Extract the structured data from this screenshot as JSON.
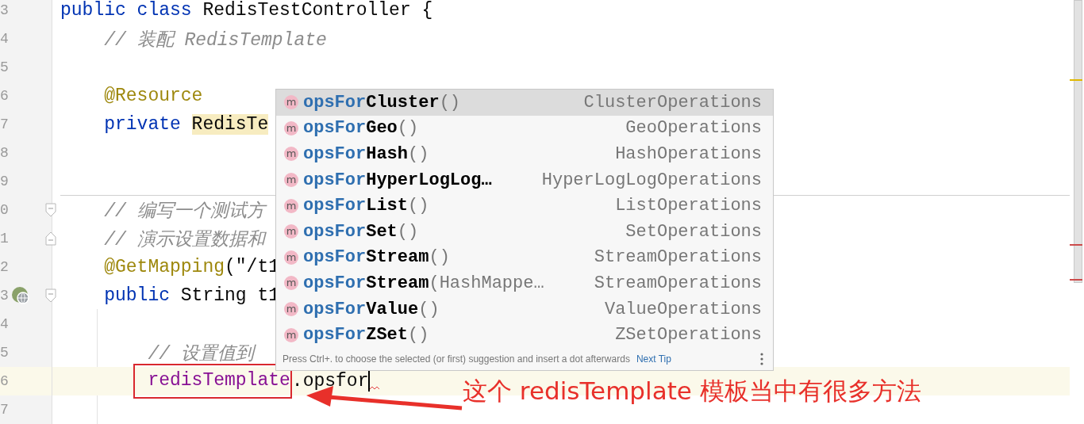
{
  "editor": {
    "lines": [
      {
        "number": "3",
        "kind": "class",
        "tokens": [
          {
            "kind": "keyword",
            "text": "public class "
          },
          {
            "kind": "plain",
            "text": "RedisTestController {"
          }
        ]
      },
      {
        "number": "4",
        "kind": "member",
        "tokens": [
          {
            "kind": "comment",
            "text": "// 装配 RedisTemplate"
          }
        ]
      },
      {
        "number": "5",
        "kind": "blank"
      },
      {
        "number": "6",
        "kind": "member",
        "tokens": [
          {
            "kind": "annotation",
            "text": "@Resource"
          }
        ]
      },
      {
        "number": "7",
        "kind": "member",
        "tokens": [
          {
            "kind": "keyword",
            "text": "private "
          },
          {
            "kind": "highlight",
            "text": "RedisTe"
          }
        ]
      },
      {
        "number": "8",
        "kind": "blank"
      },
      {
        "number": "9",
        "kind": "blank",
        "separator": true
      },
      {
        "number": "0",
        "kind": "member",
        "gutter": [
          {
            "kind": "fold-start"
          }
        ],
        "tokens": [
          {
            "kind": "comment",
            "text": "// 编写一个测试方"
          }
        ]
      },
      {
        "number": "1",
        "kind": "member",
        "gutter": [
          {
            "kind": "fold-end"
          }
        ],
        "tokens": [
          {
            "kind": "comment",
            "text": "// 演示设置数据和"
          }
        ]
      },
      {
        "number": "2",
        "kind": "member",
        "tokens": [
          {
            "kind": "annotation",
            "text": "@GetMapping"
          },
          {
            "kind": "plain",
            "text": "(\"/t1"
          }
        ]
      },
      {
        "number": "3",
        "kind": "member",
        "gutter": [
          {
            "kind": "endpoint"
          },
          {
            "kind": "fold-start"
          }
        ],
        "tokens": [
          {
            "kind": "keyword",
            "text": "public "
          },
          {
            "kind": "plain",
            "text": "String t1"
          }
        ]
      },
      {
        "number": "4",
        "kind": "blank"
      },
      {
        "number": "5",
        "kind": "statement",
        "tokens": [
          {
            "kind": "comment",
            "text": "// 设置值到"
          }
        ]
      },
      {
        "number": "6",
        "kind": "statement",
        "current": true,
        "tokens": [
          {
            "kind": "field",
            "text": "redisTemplate",
            "framed": true
          },
          {
            "kind": "plain",
            "text": ".opsfor"
          }
        ]
      },
      {
        "number": "7",
        "kind": "blank"
      }
    ]
  },
  "completion": {
    "items": [
      {
        "icon": "m",
        "match": "opsFor",
        "name": "Cluster",
        "params": "()",
        "type": "ClusterOperations",
        "selected": true
      },
      {
        "icon": "m",
        "match": "opsFor",
        "name": "Geo",
        "params": "()",
        "type": "GeoOperations",
        "selected": false
      },
      {
        "icon": "m",
        "match": "opsFor",
        "name": "Hash",
        "params": "()",
        "type": "HashOperations",
        "selected": false
      },
      {
        "icon": "m",
        "match": "opsFor",
        "name": "HyperLogLog…",
        "type": "HyperLogLogOperations",
        "selected": false
      },
      {
        "icon": "m",
        "match": "opsFor",
        "name": "List",
        "params": "()",
        "type": "ListOperations",
        "selected": false
      },
      {
        "icon": "m",
        "match": "opsFor",
        "name": "Set",
        "params": "()",
        "type": "SetOperations",
        "selected": false
      },
      {
        "icon": "m",
        "match": "opsFor",
        "name": "Stream",
        "params": "()",
        "type": "StreamOperations",
        "selected": false
      },
      {
        "icon": "m",
        "match": "opsFor",
        "name": "Stream",
        "params": "(HashMappe…",
        "type": "StreamOperations",
        "selected": false
      },
      {
        "icon": "m",
        "match": "opsFor",
        "name": "Value",
        "params": "()",
        "type": "ValueOperations",
        "selected": false
      },
      {
        "icon": "m",
        "match": "opsFor",
        "name": "ZSet",
        "params": "()",
        "type": "ZSetOperations",
        "selected": false
      }
    ],
    "hint": "Press Ctrl+. to choose the selected (or first) suggestion and insert a dot afterwards",
    "next_tip": "Next Tip"
  },
  "annotation": {
    "text": "这个 redisTemplate 模板当中有很多方法"
  }
}
